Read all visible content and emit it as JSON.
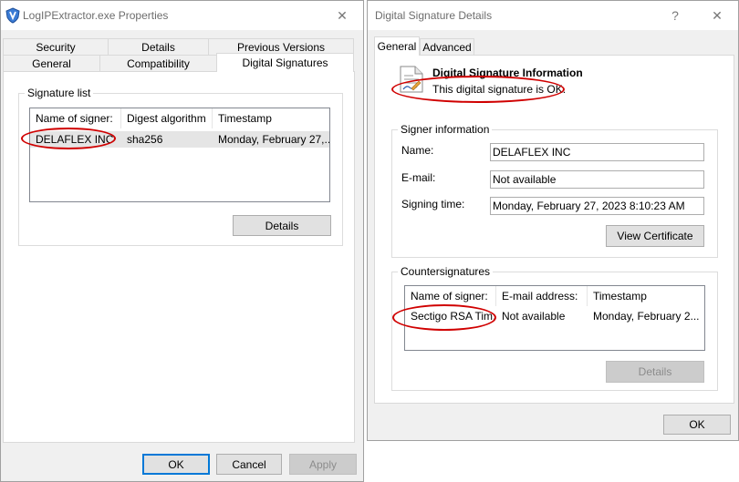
{
  "left_window": {
    "title": "LogIPExtractor.exe Properties",
    "tabs_top": [
      "Security",
      "Details",
      "Previous Versions"
    ],
    "tabs_bottom": [
      "General",
      "Compatibility",
      "Digital Signatures"
    ],
    "signature_list": {
      "group_label": "Signature list",
      "columns": [
        "Name of signer:",
        "Digest algorithm",
        "Timestamp"
      ],
      "rows": [
        [
          "DELAFLEX INC",
          "sha256",
          "Monday, February 27,..."
        ]
      ]
    },
    "details_button": "Details",
    "ok_button": "OK",
    "cancel_button": "Cancel",
    "apply_button": "Apply"
  },
  "right_window": {
    "title": "Digital Signature Details",
    "help_button": "?",
    "tabs": [
      "General",
      "Advanced"
    ],
    "info_heading": "Digital Signature Information",
    "info_status": "This digital signature is OK.",
    "signer_info": {
      "group_label": "Signer information",
      "name_label": "Name:",
      "name_value": "DELAFLEX INC",
      "email_label": "E-mail:",
      "email_value": "Not available",
      "time_label": "Signing time:",
      "time_value": "Monday, February 27, 2023 8:10:23 AM"
    },
    "view_certificate_button": "View Certificate",
    "countersignatures": {
      "group_label": "Countersignatures",
      "columns": [
        "Name of signer:",
        "E-mail address:",
        "Timestamp"
      ],
      "rows": [
        [
          "Sectigo RSA Tim...",
          "Not available",
          "Monday, February 2..."
        ]
      ]
    },
    "details_button": "Details",
    "ok_button": "OK"
  },
  "colors": {
    "annotation": "#d00000",
    "window_bg": "#f0f0f0",
    "accent": "#0078d7"
  }
}
